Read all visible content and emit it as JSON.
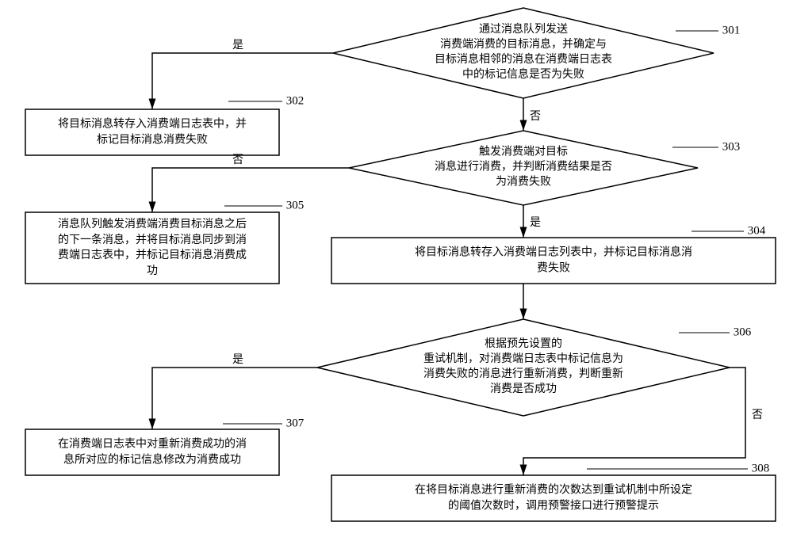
{
  "nodes": {
    "d301": "通过消息队列发送\n消费端消费的目标消息，并确定与\n目标消息相邻的消息在消费端日志表\n中的标记信息是否为失败",
    "r302": "将目标消息转存入消费端日志表中，并\n标记目标消息消费失败",
    "d303": "触发消费端对目标\n消息进行消费，并判断消费结果是否\n为消费失败",
    "r304": "将目标消息转存入消费端日志列表中，并标记目标消息消\n费失败",
    "r305": "消息队列触发消费端消费目标消息之后\n的下一条消息，并将目标消息同步到消\n费端日志表中，并标记目标消息消费成\n功",
    "d306": "根据预先设置的\n重试机制，对消费端日志表中标记信息为\n消费失败的消息进行重新消费，判断重新\n消费是否成功",
    "r307": "在消费端日志表中对重新消费成功的消\n息所对应的标记信息修改为消费成功",
    "r308": "在将目标消息进行重新消费的次数达到重试机制中所设定\n的阈值次数时，调用预警接口进行预警提示"
  },
  "refs": {
    "n301": "301",
    "n302": "302",
    "n303": "303",
    "n304": "304",
    "n305": "305",
    "n306": "306",
    "n307": "307",
    "n308": "308"
  },
  "labels": {
    "yes": "是",
    "no": "否"
  }
}
